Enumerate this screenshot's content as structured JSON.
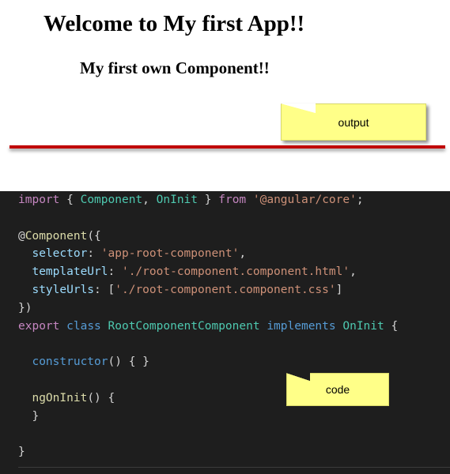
{
  "output": {
    "heading": "Welcome to My first App!!",
    "subheading": "My first own Component!!",
    "note_label": "output",
    "divider_color": "#c00000"
  },
  "code": {
    "note_label": "code",
    "lines": [
      [
        [
          "kw",
          "import"
        ],
        [
          "p",
          " { "
        ],
        [
          "type",
          "Component"
        ],
        [
          "p",
          ", "
        ],
        [
          "type",
          "OnInit"
        ],
        [
          "p",
          " } "
        ],
        [
          "kw",
          "from"
        ],
        [
          "p",
          " "
        ],
        [
          "str",
          "'@angular/core'"
        ],
        [
          "p",
          ";"
        ]
      ],
      [],
      [
        [
          "p",
          "@"
        ],
        [
          "fn",
          "Component"
        ],
        [
          "p",
          "({"
        ]
      ],
      [
        [
          "p",
          "  "
        ],
        [
          "var",
          "selector"
        ],
        [
          "p",
          ": "
        ],
        [
          "str",
          "'app-root-component'"
        ],
        [
          "p",
          ","
        ]
      ],
      [
        [
          "p",
          "  "
        ],
        [
          "var",
          "templateUrl"
        ],
        [
          "p",
          ": "
        ],
        [
          "str",
          "'./root-component.component.html'"
        ],
        [
          "p",
          ","
        ]
      ],
      [
        [
          "p",
          "  "
        ],
        [
          "var",
          "styleUrls"
        ],
        [
          "p",
          ": ["
        ],
        [
          "str",
          "'./root-component.component.css'"
        ],
        [
          "p",
          "]"
        ]
      ],
      [
        [
          "p",
          "})"
        ]
      ],
      [
        [
          "kw",
          "export"
        ],
        [
          "p",
          " "
        ],
        [
          "blue",
          "class"
        ],
        [
          "p",
          " "
        ],
        [
          "type",
          "RootComponentComponent"
        ],
        [
          "p",
          " "
        ],
        [
          "blue",
          "implements"
        ],
        [
          "p",
          " "
        ],
        [
          "type",
          "OnInit"
        ],
        [
          "p",
          " {"
        ]
      ],
      [],
      [
        [
          "p",
          "  "
        ],
        [
          "blue",
          "constructor"
        ],
        [
          "p",
          "() { }"
        ]
      ],
      [],
      [
        [
          "p",
          "  "
        ],
        [
          "fn",
          "ngOnInit"
        ],
        [
          "p",
          "() {"
        ]
      ],
      [
        [
          "p",
          "  }"
        ]
      ],
      [],
      [
        [
          "p",
          "}"
        ]
      ]
    ],
    "colors": {
      "background": "#1e1e1e",
      "keyword": "#c586c0",
      "storage": "#569cd6",
      "type": "#4ec9b0",
      "property": "#9cdcfe",
      "string": "#ce9178",
      "function": "#dcdcaa",
      "punctuation": "#d4d4d4"
    }
  },
  "note_color": "#ffff88"
}
